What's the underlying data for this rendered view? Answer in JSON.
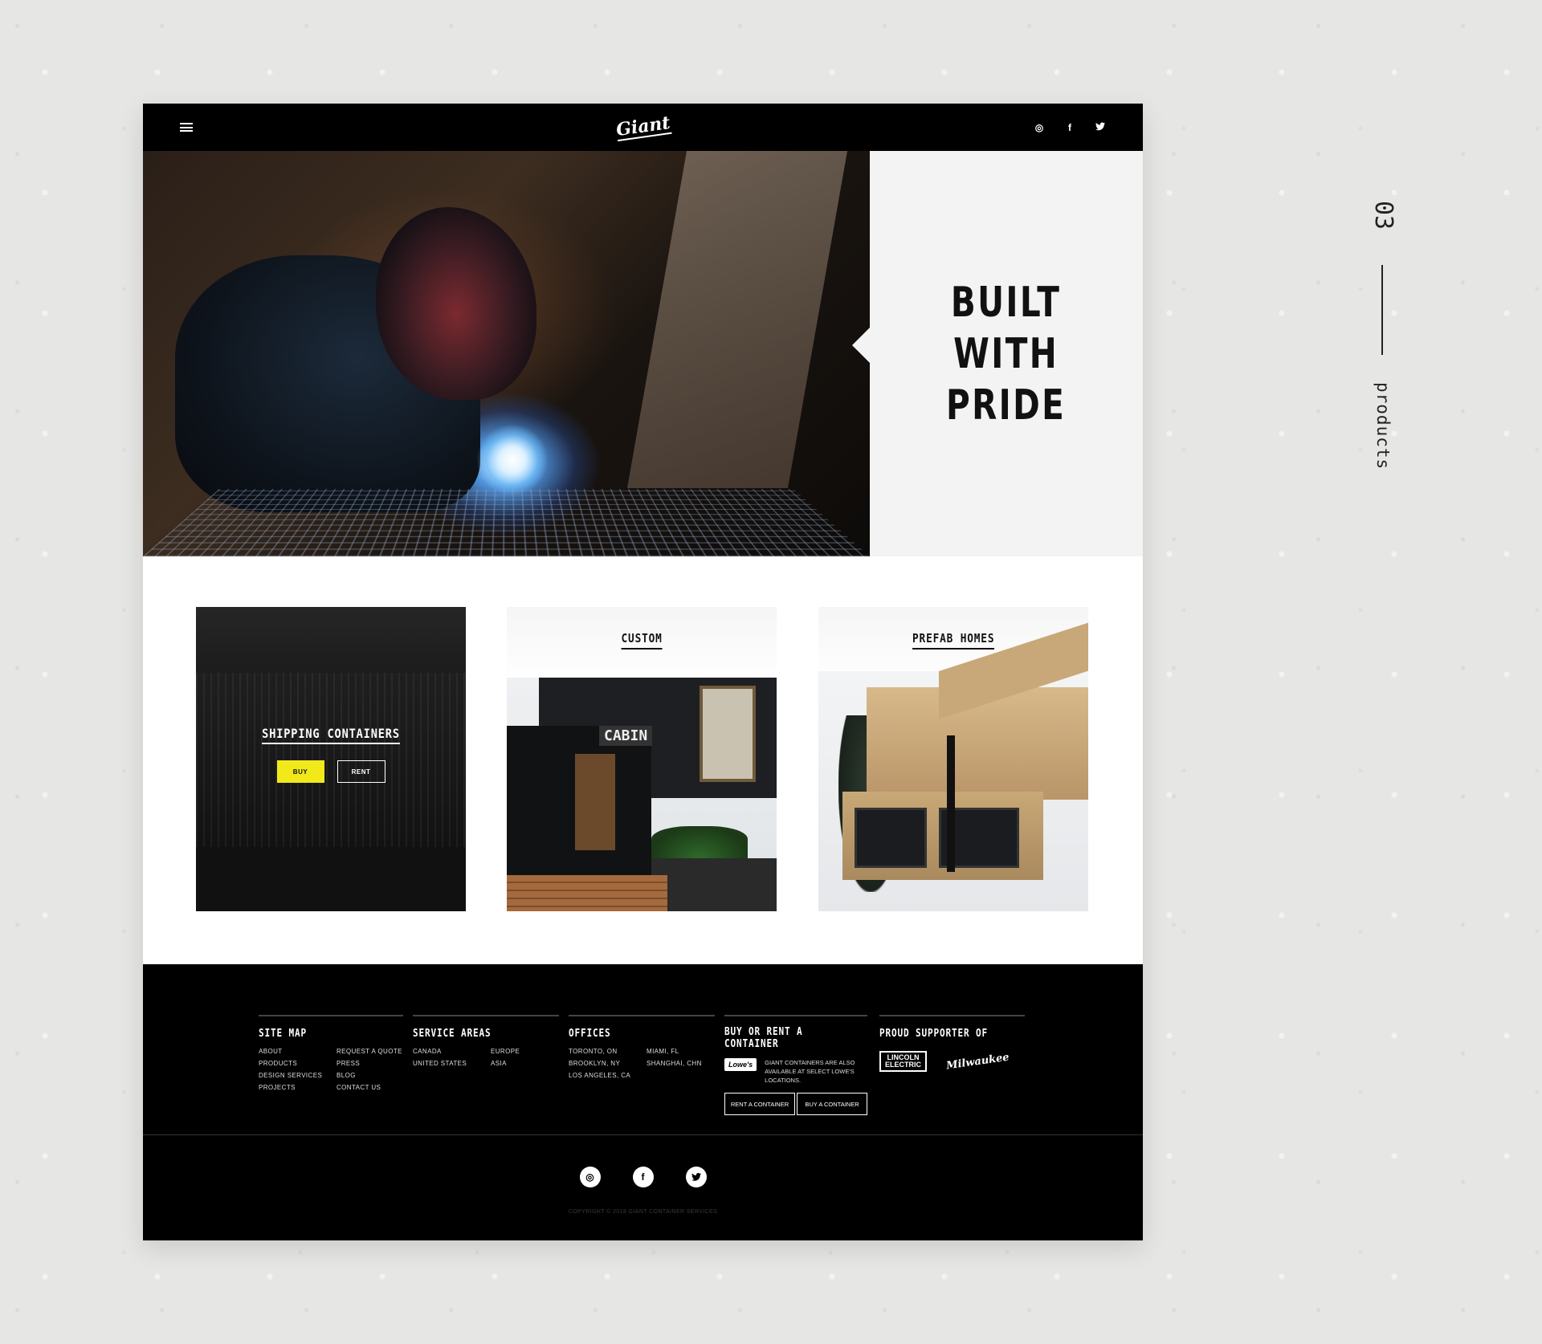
{
  "nav": {
    "logo": "Giant",
    "social_icons": [
      "instagram-icon",
      "facebook-icon",
      "twitter-icon"
    ],
    "instagram_glyph": "◎",
    "facebook_glyph": "f",
    "twitter_glyph": "🐦"
  },
  "hero": {
    "title_line1": "BUILT",
    "title_line2": "WITH",
    "title_line3": "PRIDE"
  },
  "products": {
    "shipping": {
      "label": "SHIPPING CONTAINERS",
      "buy_label": "BUY",
      "rent_label": "RENT"
    },
    "custom": {
      "label": "CUSTOM",
      "sign_text": "CABIN"
    },
    "prefab": {
      "label": "PREFAB HOMES"
    }
  },
  "footer": {
    "site_map": {
      "heading": "SITE MAP",
      "links": [
        "ABOUT",
        "REQUEST A QUOTE",
        "PRODUCTS",
        "PRESS",
        "DESIGN SERVICES",
        "BLOG",
        "PROJECTS",
        "CONTACT US"
      ]
    },
    "service_areas": {
      "heading": "SERVICE AREAS",
      "items": [
        "CANADA",
        "EUROPE",
        "UNITED STATES",
        "ASIA"
      ]
    },
    "offices": {
      "heading": "OFFICES",
      "items": [
        "TORONTO, ON",
        "MIAMI, FL",
        "BROOKLYN, NY",
        "SHANGHAI, CHN",
        "LOS ANGELES, CA"
      ]
    },
    "buy_rent": {
      "heading": "BUY OR RENT A CONTAINER",
      "lowes_logo": "Lowe's",
      "lowes_text": "GIANT CONTAINERS ARE ALSO AVAILABLE AT SELECT LOWE'S LOCATIONS.",
      "rent_button": "RENT A CONTAINER",
      "buy_button": "BUY A CONTAINER"
    },
    "supporter": {
      "heading": "PROUD SUPPORTER OF",
      "lincoln_line1": "LINCOLN",
      "lincoln_line2": "ELECTRIC",
      "milwaukee": "Milwaukee"
    },
    "copyright": "COPYRIGHT © 2018 GIANT CONTAINER SERVICES"
  },
  "side": {
    "number": "03",
    "label": "products"
  },
  "colors": {
    "accent_yellow": "#f2e91b",
    "black": "#000000",
    "hero_side_bg": "#f3f3f3"
  }
}
